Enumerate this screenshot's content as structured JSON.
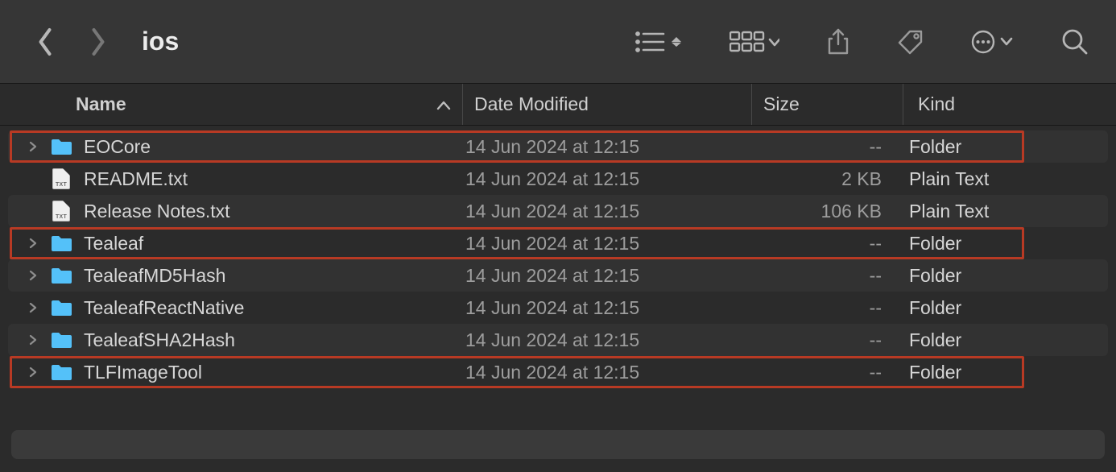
{
  "window": {
    "title": "ios"
  },
  "columns": {
    "name": "Name",
    "date": "Date Modified",
    "size": "Size",
    "kind": "Kind"
  },
  "rows": [
    {
      "name": "EOCore",
      "date": "14 Jun 2024 at 12:15",
      "size": "--",
      "kind": "Folder",
      "type": "folder",
      "highlight": true
    },
    {
      "name": "README.txt",
      "date": "14 Jun 2024 at 12:15",
      "size": "2 KB",
      "kind": "Plain Text",
      "type": "txt",
      "highlight": false
    },
    {
      "name": "Release Notes.txt",
      "date": "14 Jun 2024 at 12:15",
      "size": "106 KB",
      "kind": "Plain Text",
      "type": "txt",
      "highlight": false
    },
    {
      "name": "Tealeaf",
      "date": "14 Jun 2024 at 12:15",
      "size": "--",
      "kind": "Folder",
      "type": "folder",
      "highlight": true
    },
    {
      "name": "TealeafMD5Hash",
      "date": "14 Jun 2024 at 12:15",
      "size": "--",
      "kind": "Folder",
      "type": "folder",
      "highlight": false
    },
    {
      "name": "TealeafReactNative",
      "date": "14 Jun 2024 at 12:15",
      "size": "--",
      "kind": "Folder",
      "type": "folder",
      "highlight": false
    },
    {
      "name": "TealeafSHA2Hash",
      "date": "14 Jun 2024 at 12:15",
      "size": "--",
      "kind": "Folder",
      "type": "folder",
      "highlight": false
    },
    {
      "name": "TLFImageTool",
      "date": "14 Jun 2024 at 12:15",
      "size": "--",
      "kind": "Folder",
      "type": "folder",
      "highlight": true
    }
  ]
}
